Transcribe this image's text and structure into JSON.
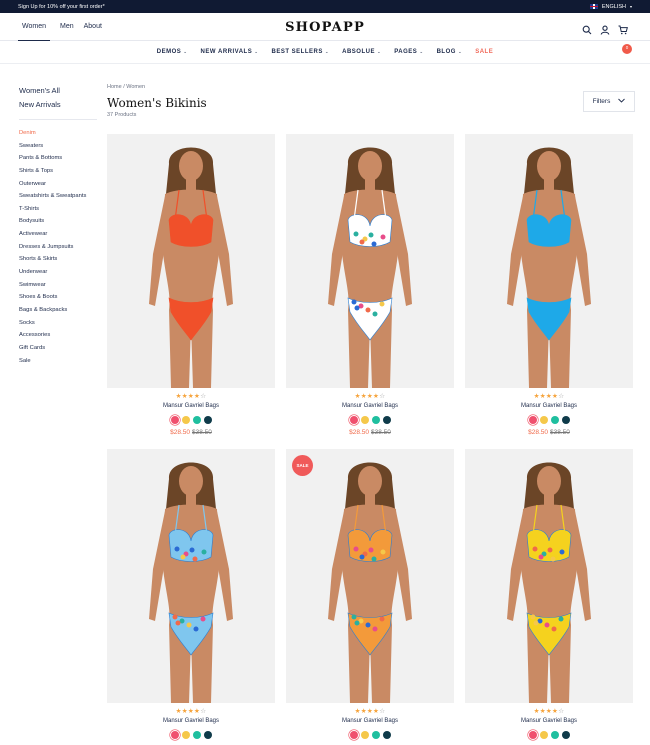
{
  "topbar": {
    "promo": "Sign Up for 10% off your first order*",
    "language": "ENGLISH"
  },
  "header": {
    "logo": "SHOPAPP",
    "gender_tabs": [
      "Women",
      "Men",
      "About"
    ],
    "cart_count": "0"
  },
  "nav": [
    {
      "label": "DEMOS",
      "caret": "⌄"
    },
    {
      "label": "NEW ARRIVALS",
      "caret": "⌄"
    },
    {
      "label": "BEST SELLERS",
      "caret": "⌄"
    },
    {
      "label": "ABSOLUE",
      "caret": "⌄"
    },
    {
      "label": "PAGES",
      "caret": "⌄"
    },
    {
      "label": "BLOG",
      "caret": "⌄"
    },
    {
      "label": "SALE",
      "caret": ""
    }
  ],
  "sidebar": {
    "top": [
      "Women's All",
      "New Arrivals"
    ],
    "categories": [
      "Denim",
      "Sweaters",
      "Pants & Bottoms",
      "Shirts & Tops",
      "Outerwear",
      "Sweatshirts & Sweatpants",
      "T-Shirts",
      "Bodysuits",
      "Activewear",
      "Dresses & Jumpsuits",
      "Shorts & Skirts",
      "Underwear",
      "Swimwear",
      "Shoes & Boots",
      "Bags & Backpacks",
      "Socks",
      "Accessories",
      "Gift Cards",
      "Sale"
    ]
  },
  "page": {
    "breadcrumb": "Home  /  Women",
    "title": "Women's Bikinis",
    "count": "37 Products",
    "filters_label": "Filters"
  },
  "colors": {
    "accent": "#f06a4a",
    "navy": "#101a33",
    "swatches": [
      "#f0506e",
      "#f5c84a",
      "#1fbf9f",
      "#0f3b4a"
    ]
  },
  "products": [
    {
      "name": "Mansur Gavriel Bags",
      "rating": 4,
      "price": "$28.50",
      "old_price": "$38.50",
      "badge": "",
      "bikini": "#f0502a",
      "pattern": "solid"
    },
    {
      "name": "Mansur Gavriel Bags",
      "rating": 4,
      "price": "$28.50",
      "old_price": "$38.50",
      "badge": "",
      "bikini": "#ffffff",
      "pattern": "print"
    },
    {
      "name": "Mansur Gavriel Bags",
      "rating": 4,
      "price": "$28.50",
      "old_price": "$38.50",
      "badge": "",
      "bikini": "#1ea9e8",
      "pattern": "solid"
    },
    {
      "name": "Mansur Gavriel Bags",
      "rating": 4,
      "price": "",
      "old_price": "",
      "badge": "",
      "bikini": "#7fc6ee",
      "pattern": "print"
    },
    {
      "name": "Mansur Gavriel Bags",
      "rating": 4,
      "price": "",
      "old_price": "",
      "badge": "SALE",
      "bikini": "#f39a3a",
      "pattern": "print"
    },
    {
      "name": "Mansur Gavriel Bags",
      "rating": 4,
      "price": "",
      "old_price": "",
      "badge": "",
      "bikini": "#f5d21e",
      "pattern": "print"
    }
  ]
}
